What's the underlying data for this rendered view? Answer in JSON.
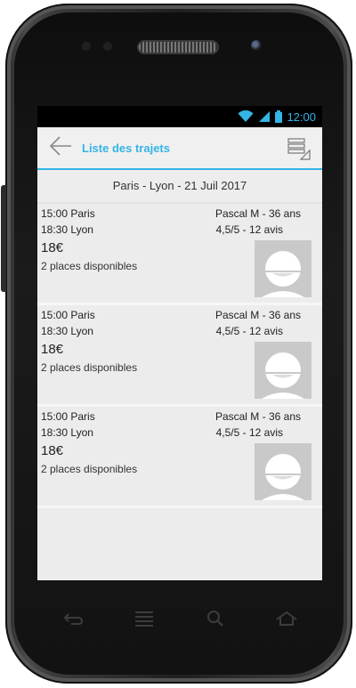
{
  "status_bar": {
    "time": "12:00",
    "icons": [
      "wifi-icon",
      "signal-icon",
      "battery-icon"
    ],
    "accent": "#33b5e5"
  },
  "action_bar": {
    "title": "Liste des trajets",
    "back_icon": "back-arrow-icon",
    "menu_icon": "list-menu-icon",
    "accent": "#33b5e5"
  },
  "route": {
    "header": "Paris - Lyon - 21 Juil 2017"
  },
  "trips": [
    {
      "departure": "15:00 Paris",
      "arrival": "18:30 Lyon",
      "price": "18€",
      "seats": "2 places disponibles",
      "driver": "Pascal M - 36 ans",
      "rating": "4,5/5 - 12 avis",
      "avatar": "avatar-placeholder-icon"
    },
    {
      "departure": "15:00 Paris",
      "arrival": "18:30 Lyon",
      "price": "18€",
      "seats": "2 places disponibles",
      "driver": "Pascal M - 36 ans",
      "rating": "4,5/5 - 12 avis",
      "avatar": "avatar-placeholder-icon"
    },
    {
      "departure": "15:00 Paris",
      "arrival": "18:30 Lyon",
      "price": "18€",
      "seats": "2 places disponibles",
      "driver": "Pascal M - 36 ans",
      "rating": "4,5/5 - 12 avis",
      "avatar": "avatar-placeholder-icon"
    }
  ],
  "nav_keys": [
    "back-key-icon",
    "menu-key-icon",
    "search-key-icon",
    "home-key-icon"
  ]
}
